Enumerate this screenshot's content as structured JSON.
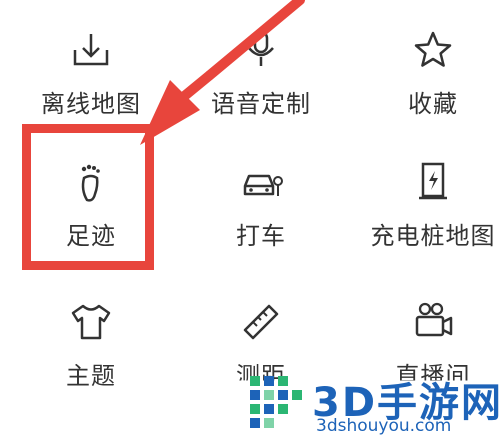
{
  "grid": {
    "items": [
      {
        "label": "离线地图",
        "icon": "offline-map-icon"
      },
      {
        "label": "语音定制",
        "icon": "microphone-icon"
      },
      {
        "label": "收藏",
        "icon": "star-icon"
      },
      {
        "label": "足迹",
        "icon": "footprint-icon"
      },
      {
        "label": "打车",
        "icon": "taxi-icon"
      },
      {
        "label": "充电桩地图",
        "icon": "charging-station-icon"
      },
      {
        "label": "主题",
        "icon": "tshirt-icon"
      },
      {
        "label": "测距",
        "icon": "ruler-icon"
      },
      {
        "label": "直播间",
        "icon": "video-camera-icon"
      }
    ]
  },
  "annotation": {
    "color": "#e8453c"
  },
  "watermark": {
    "title": "3D手游网",
    "subtitle": "3dshouyou.com",
    "color": "#1d63b8"
  }
}
